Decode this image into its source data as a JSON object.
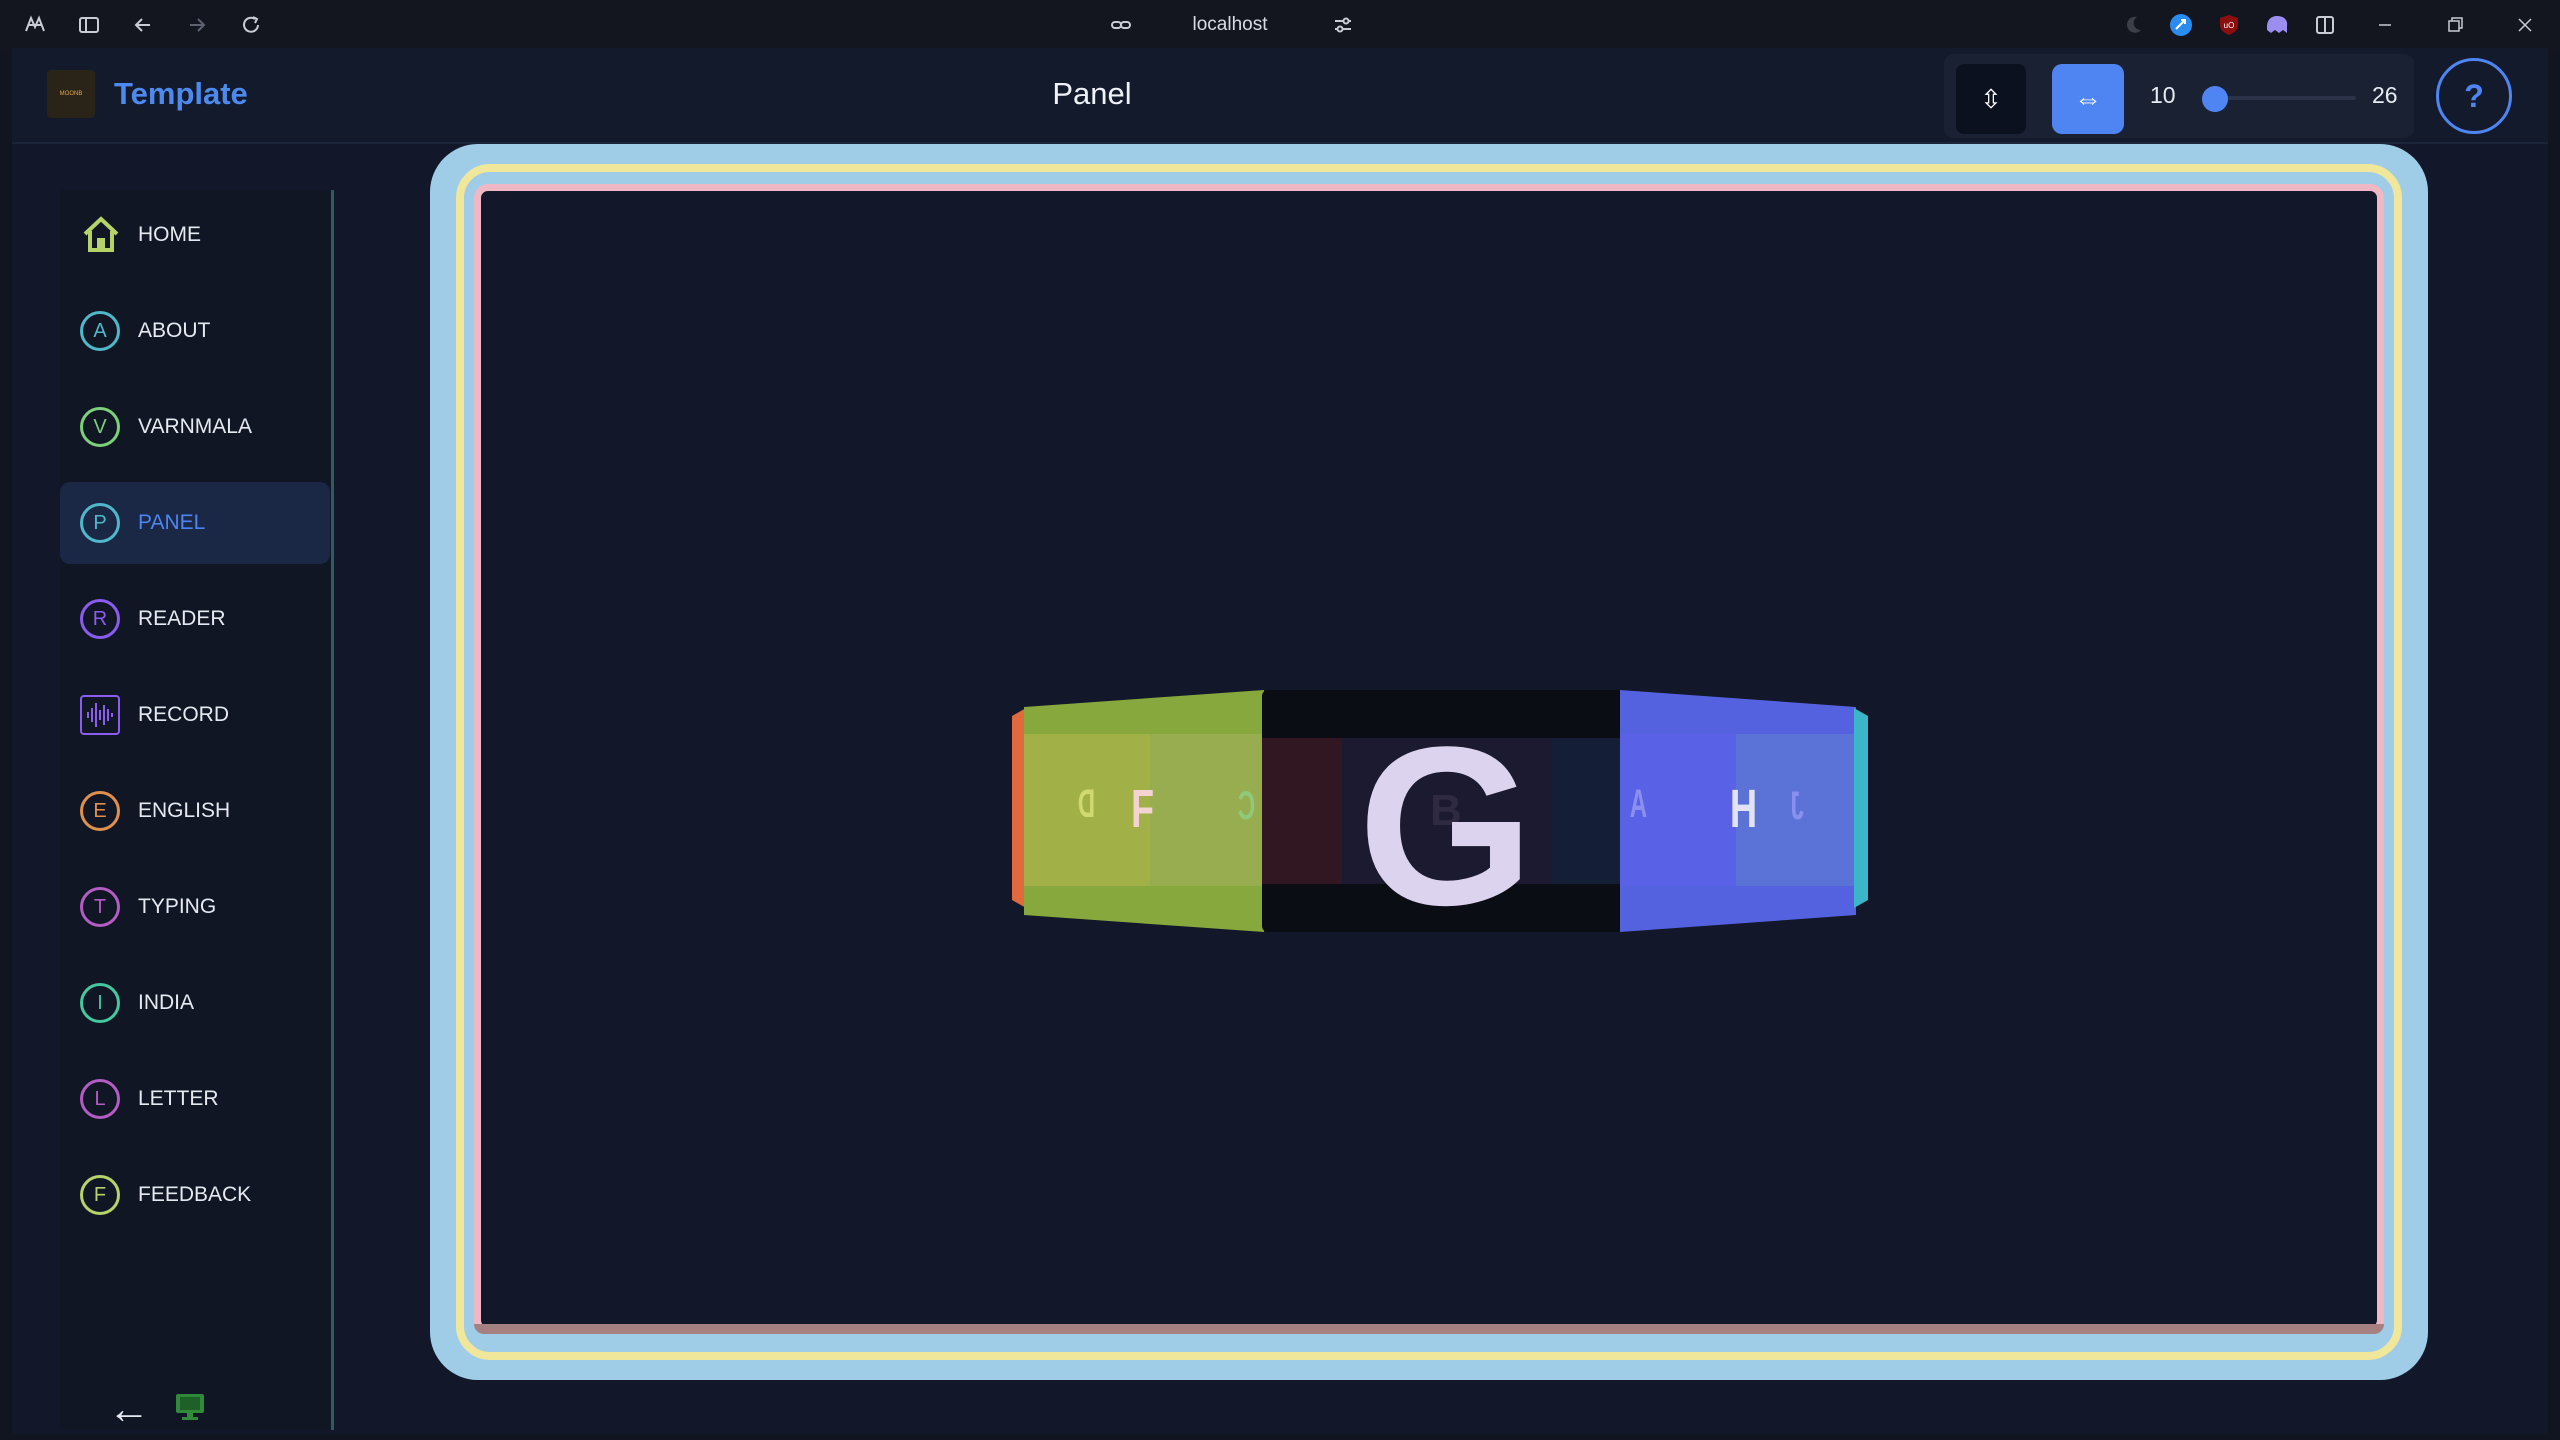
{
  "browser": {
    "url": "localhost",
    "icons": [
      "browser-logo-icon",
      "sidebar-toggle-icon",
      "back-icon",
      "forward-icon",
      "reload-icon",
      "link-icon",
      "tune-icon",
      "moon-icon",
      "extension-icon",
      "ublock-icon",
      "ghost-icon",
      "split-view-icon",
      "minimize-icon",
      "restore-icon",
      "close-icon"
    ]
  },
  "header": {
    "app_name": "Template",
    "logo_text": "MOONB",
    "page_title": "Panel"
  },
  "controls": {
    "vertical_symbol": "⇳",
    "horizontal_symbol": "⇔",
    "slider_min": "10",
    "slider_max": "26",
    "slider_fraction": 0.0,
    "help_label": "?",
    "accent": "#4e85f3"
  },
  "sidebar": {
    "items": [
      {
        "label": "HOME",
        "badge": "",
        "color": "#b6d36a",
        "icon": "home-icon"
      },
      {
        "label": "ABOUT",
        "badge": "A",
        "color": "#4fb8c9"
      },
      {
        "label": "VARNMALA",
        "badge": "V",
        "color": "#7cd07a"
      },
      {
        "label": "PANEL",
        "badge": "P",
        "color": "#4fb8c9",
        "active": true
      },
      {
        "label": "READER",
        "badge": "R",
        "color": "#8a5cf0"
      },
      {
        "label": "RECORD",
        "badge": "",
        "color": "#8a5cf0",
        "icon": "waveform-icon"
      },
      {
        "label": "ENGLISH",
        "badge": "E",
        "color": "#e0904c"
      },
      {
        "label": "TYPING",
        "badge": "T",
        "color": "#b35cc4"
      },
      {
        "label": "INDIA",
        "badge": "I",
        "color": "#45c7a0"
      },
      {
        "label": "LETTER",
        "badge": "L",
        "color": "#b35cc4"
      },
      {
        "label": "FEEDBACK",
        "badge": "F",
        "color": "#b6d36a"
      }
    ],
    "back_symbol": "←"
  },
  "carousel": {
    "current": "G",
    "left_letters": [
      "D",
      "F",
      "C"
    ],
    "right_letters": [
      "A",
      "H",
      "J"
    ],
    "hidden_letter": "B",
    "colors": {
      "orange": "#e06a3e",
      "green": "#86a83c",
      "dark": "#0b0d14",
      "blue": "#5462e0",
      "teal": "#3bb5c8"
    }
  }
}
